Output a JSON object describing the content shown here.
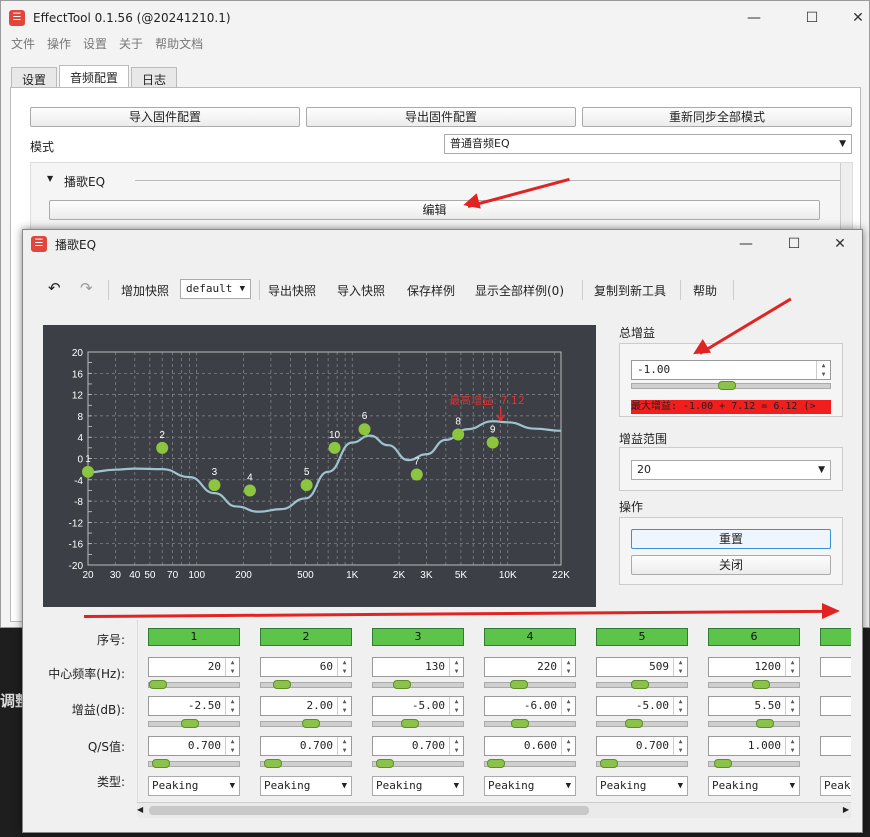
{
  "bg": {
    "text": "调整"
  },
  "main": {
    "title": "EffectTool 0.1.56  (@20241210.1)",
    "menu": [
      "文件",
      "操作",
      "设置",
      "关于",
      "帮助文档"
    ],
    "tabs": [
      "设置",
      "音频配置",
      "日志"
    ],
    "buttons": {
      "import": "导入固件配置",
      "export": "导出固件配置",
      "resync": "重新同步全部模式"
    },
    "mode_label": "模式",
    "mode_value": "普通音频EQ",
    "section_label": "播歌EQ",
    "edit_button": "编辑"
  },
  "eq": {
    "title": "播歌EQ",
    "toolbar": {
      "add_snapshot": "增加快照",
      "snapshot_value": "default",
      "export_snapshot": "导出快照",
      "import_snapshot": "导入快照",
      "save_sample": "保存样例",
      "show_all": "显示全部样例(0)",
      "copy": "复制到新工具",
      "help": "帮助"
    },
    "total_gain_label": "总增益",
    "total_gain_value": "-1.00",
    "max_gain_text": "最大增益: -1.00 + 7.12 = 6.12 (> ",
    "gain_range_label": "增益范围",
    "gain_range_value": "20",
    "ops_label": "操作",
    "reset": "重置",
    "close": "关闭",
    "row_labels": {
      "index": "序号:",
      "freq": "中心频率(Hz):",
      "gain": "增益(dB):",
      "q": "Q/S值:",
      "type": "类型:"
    },
    "bands": [
      {
        "index": "1",
        "freq": "20",
        "gain": "-2.50",
        "q": "0.700",
        "type": "Peaking"
      },
      {
        "index": "2",
        "freq": "60",
        "gain": "2.00",
        "q": "0.700",
        "type": "Peaking"
      },
      {
        "index": "3",
        "freq": "130",
        "gain": "-5.00",
        "q": "0.700",
        "type": "Peaking"
      },
      {
        "index": "4",
        "freq": "220",
        "gain": "-6.00",
        "q": "0.600",
        "type": "Peaking"
      },
      {
        "index": "5",
        "freq": "509",
        "gain": "-5.00",
        "q": "0.700",
        "type": "Peaking"
      },
      {
        "index": "6",
        "freq": "1200",
        "gain": "5.50",
        "q": "1.000",
        "type": "Peaking"
      }
    ],
    "partial_type": "Peaki"
  },
  "chart_data": {
    "type": "line",
    "y_ticks": [
      "20",
      "16",
      "12",
      "8",
      "4",
      "0",
      "-4",
      "-8",
      "-12",
      "-16",
      "-20"
    ],
    "x_ticks": [
      "20",
      "30",
      "40",
      "50",
      "70",
      "100",
      "200",
      "500",
      "1K",
      "2K",
      "3K",
      "5K",
      "10K",
      "22K"
    ],
    "ylim": [
      -20,
      20
    ],
    "xlim": [
      20,
      22000
    ],
    "x_scale": "log",
    "annotation": "最高增益: 7.12",
    "points": [
      {
        "label": "1",
        "x": 20,
        "y": -2.5
      },
      {
        "label": "2",
        "x": 60,
        "y": 2.0
      },
      {
        "label": "3",
        "x": 130,
        "y": -5.0
      },
      {
        "label": "4",
        "x": 220,
        "y": -6.0
      },
      {
        "label": "5",
        "x": 509,
        "y": -5.0
      },
      {
        "label": "10",
        "x": 770,
        "y": 2.0
      },
      {
        "label": "6",
        "x": 1200,
        "y": 5.5
      },
      {
        "label": "7",
        "x": 2600,
        "y": -3.0
      },
      {
        "label": "8",
        "x": 4800,
        "y": 4.5
      },
      {
        "label": "9",
        "x": 8000,
        "y": 3.0
      }
    ],
    "curve": [
      [
        20,
        -2.6
      ],
      [
        30,
        -2.1
      ],
      [
        40,
        -1.9
      ],
      [
        60,
        -2.0
      ],
      [
        90,
        -3.5
      ],
      [
        130,
        -6.5
      ],
      [
        180,
        -9.0
      ],
      [
        250,
        -10.0
      ],
      [
        350,
        -9.5
      ],
      [
        500,
        -7.5
      ],
      [
        700,
        -2.5
      ],
      [
        1000,
        3.0
      ],
      [
        1300,
        4.3
      ],
      [
        1700,
        2.5
      ],
      [
        2300,
        -0.3
      ],
      [
        3000,
        0.8
      ],
      [
        4000,
        3.5
      ],
      [
        5500,
        5.5
      ],
      [
        8000,
        7.0
      ],
      [
        10000,
        6.8
      ],
      [
        15000,
        5.6
      ],
      [
        22000,
        5.2
      ]
    ]
  }
}
